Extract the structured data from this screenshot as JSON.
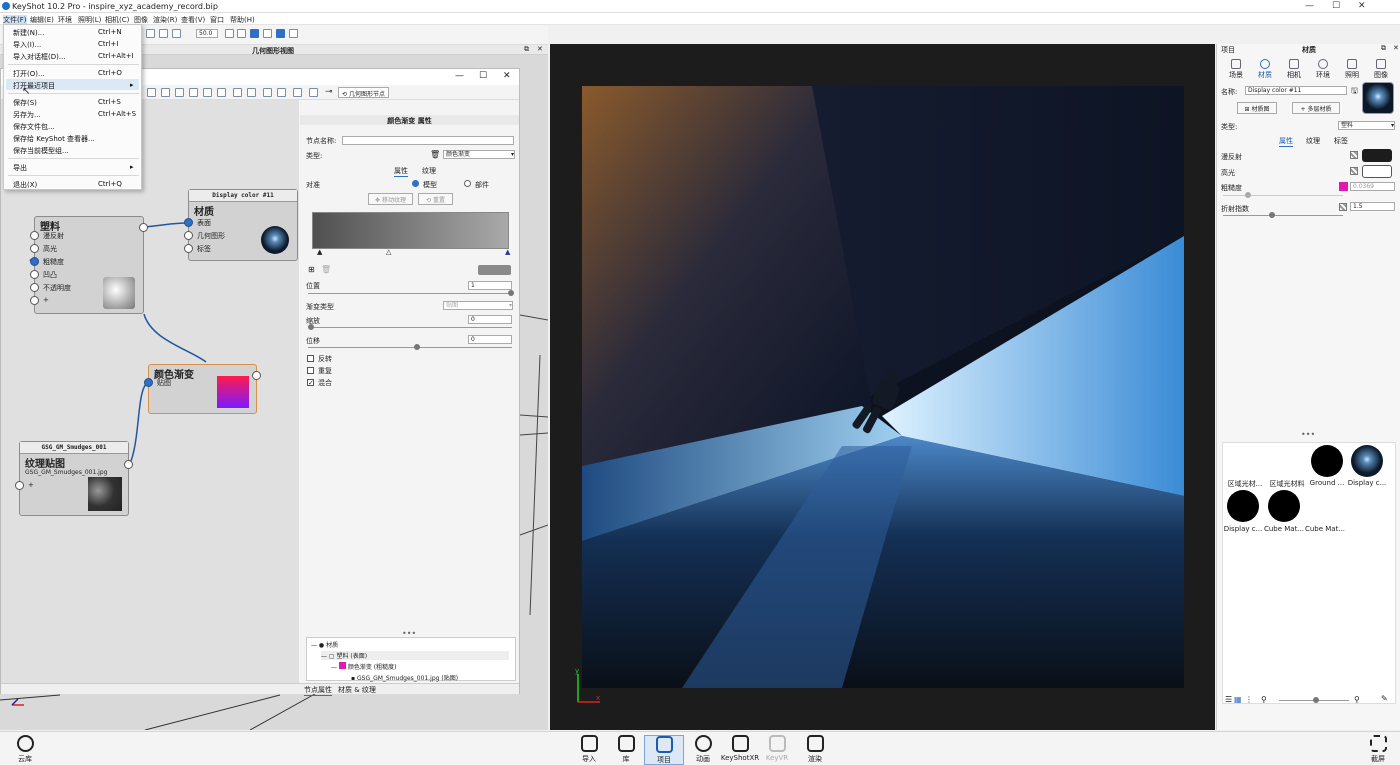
{
  "app": {
    "title": "KeyShot 10.2 Pro  - inspire_xyz_academy_record.bip"
  },
  "menubar": [
    "文件(F)",
    "编辑(E)",
    "环境",
    "照明(L)",
    "相机(C)",
    "图像",
    "渲染(R)",
    "查看(V)",
    "窗口",
    "帮助(H)"
  ],
  "toolbar": {
    "zoom_value": "50.0"
  },
  "geometry_view": {
    "title": "几何图形视图"
  },
  "file_menu": [
    {
      "label": "新建(N)...",
      "shortcut": "Ctrl+N"
    },
    {
      "label": "导入(I)...",
      "shortcut": "Ctrl+I"
    },
    {
      "label": "导入对话框(D)...",
      "shortcut": "Ctrl+Alt+I"
    },
    {
      "label": "打开(O)...",
      "shortcut": "Ctrl+O"
    },
    {
      "label": "打开最近项目",
      "shortcut": "▸"
    },
    {
      "label": "保存(S)",
      "shortcut": "Ctrl+S"
    },
    {
      "label": "另存为...",
      "shortcut": "Ctrl+Alt+S"
    },
    {
      "label": "保存文件包...",
      "shortcut": ""
    },
    {
      "label": "保存给 KeyShot 查看器...",
      "shortcut": ""
    },
    {
      "label": "保存当前模型组...",
      "shortcut": ""
    },
    {
      "label": "导出",
      "shortcut": "▸"
    },
    {
      "label": "退出(X)",
      "shortcut": "Ctrl+Q"
    }
  ],
  "material_graph": {
    "geo_node_button": "几何图形节点",
    "nodes": {
      "plastic": {
        "title": "塑料",
        "ports": [
          "漫反射",
          "高光",
          "粗糙度",
          "凹凸",
          "不透明度",
          "+"
        ]
      },
      "material": {
        "header": "Display color #11",
        "title": "材质",
        "ports": [
          "表面",
          "几何图形",
          "标签"
        ]
      },
      "gradient": {
        "title": "颜色渐变",
        "ports": [
          "贴图"
        ]
      },
      "texture": {
        "header": "GSG_GM_Smudges_001",
        "title": "纹理贴图",
        "file": "GSG_GM_Smudges_001.jpg",
        "ports": [
          "+"
        ]
      }
    }
  },
  "properties": {
    "header": "颜色渐变 属性",
    "node_name_label": "节点名称:",
    "node_name_value": "",
    "type_label": "类型:",
    "type_value": "颜色渐变",
    "tabs": [
      "属性",
      "纹理"
    ],
    "target_label": "对准",
    "target_options": [
      "模型",
      "部件"
    ],
    "move_texture_btn": "移动纹理",
    "reset_btn": "重置",
    "position_label": "位置",
    "position_value": "1",
    "gradient_type_label": "渐变类型",
    "gradient_type_value": "贴图",
    "scale_label": "缩放",
    "scale_value": "0",
    "offset_label": "位移",
    "offset_value": "0",
    "checkboxes": [
      {
        "label": "反转",
        "checked": false
      },
      {
        "label": "重复",
        "checked": false
      },
      {
        "label": "混合",
        "checked": true
      }
    ]
  },
  "tree": [
    "材质",
    "塑料 (表面)",
    "颜色渐变 (粗糙度)",
    "GSG_GM_Smudges_001.jpg (贴图)"
  ],
  "bottom_tabs": [
    "节点属性",
    "材质 & 纹理"
  ],
  "right_panel": {
    "header_left": "项目",
    "header_center": "材质",
    "tabs": [
      "场景",
      "材质",
      "相机",
      "环境",
      "照明",
      "图像"
    ],
    "name_label": "名称:",
    "name_value": "Display color #11",
    "graph_btn": "材质图",
    "multi_btn": "多层材质",
    "type_label": "类型:",
    "type_value": "塑料",
    "subtabs": [
      "属性",
      "纹理",
      "标签"
    ],
    "diffuse_label": "漫反射",
    "diffuse_color": "#1c1c1c",
    "specular_label": "高光",
    "specular_color": "#ffffff",
    "roughness_label": "粗糙度",
    "roughness_value": "0.0369",
    "roughness_color": "#e01ab0",
    "ior_label": "折射指数",
    "ior_value": "1.5"
  },
  "library": [
    {
      "label": "区域光材...",
      "style": "blank"
    },
    {
      "label": "区域光材料",
      "style": "blank"
    },
    {
      "label": "Ground ...",
      "style": "black"
    },
    {
      "label": "Display c...",
      "style": "blue"
    },
    {
      "label": "Display c...",
      "style": "black"
    },
    {
      "label": "Cube Mat...",
      "style": "black"
    },
    {
      "label": "Cube Mat...",
      "style": "none"
    }
  ],
  "bottom_bar": {
    "left": "云库",
    "items": [
      "导入",
      "库",
      "项目",
      "动画",
      "KeyShotXR",
      "KeyVR",
      "渲染"
    ],
    "right": "截屏"
  }
}
